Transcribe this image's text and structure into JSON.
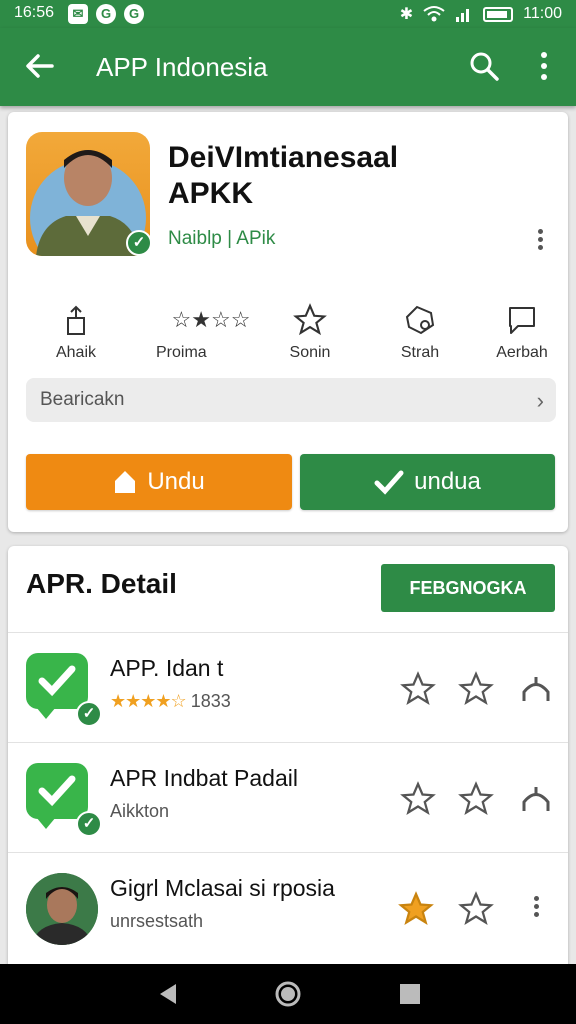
{
  "status_bar": {
    "time_left": "16:56",
    "notifications": [
      "✉",
      "G",
      "G"
    ],
    "time_right": "11:00"
  },
  "app_bar": {
    "title": "APP Indonesia",
    "back_icon": "arrow-left-icon",
    "search_icon": "search-icon",
    "more_icon": "more-vert-icon"
  },
  "app_card": {
    "name": "DeiVImtianesaal APKK",
    "developer": "Naiblp | APik",
    "actions": [
      {
        "label": "Ahaik",
        "icon": "share-icon"
      },
      {
        "label": "Proima",
        "icon": "stars-rating-icon"
      },
      {
        "label": "Sonin",
        "icon": "star-icon"
      },
      {
        "label": "Strah",
        "icon": "tag-icon"
      },
      {
        "label": "Aerbah",
        "icon": "chat-icon"
      }
    ],
    "dropdown": {
      "value": "Bearicakn"
    },
    "download_button": "Undu",
    "install_button": "undua"
  },
  "detail_section": {
    "title": "APR. Detail",
    "action_button": "FEBGNOGKA",
    "rows": [
      {
        "title": "APP. Idan t",
        "sub_rating": 4,
        "sub_text": "1833"
      },
      {
        "title": "APR Indbat Padail",
        "sub_text": "Aikkton"
      },
      {
        "title": "Gigrl Mclasai si rposia",
        "sub_text": "unrsestsath"
      }
    ]
  },
  "colors": {
    "primary": "#2e8b46",
    "accent": "#ef8a12",
    "star": "#f0a020"
  }
}
